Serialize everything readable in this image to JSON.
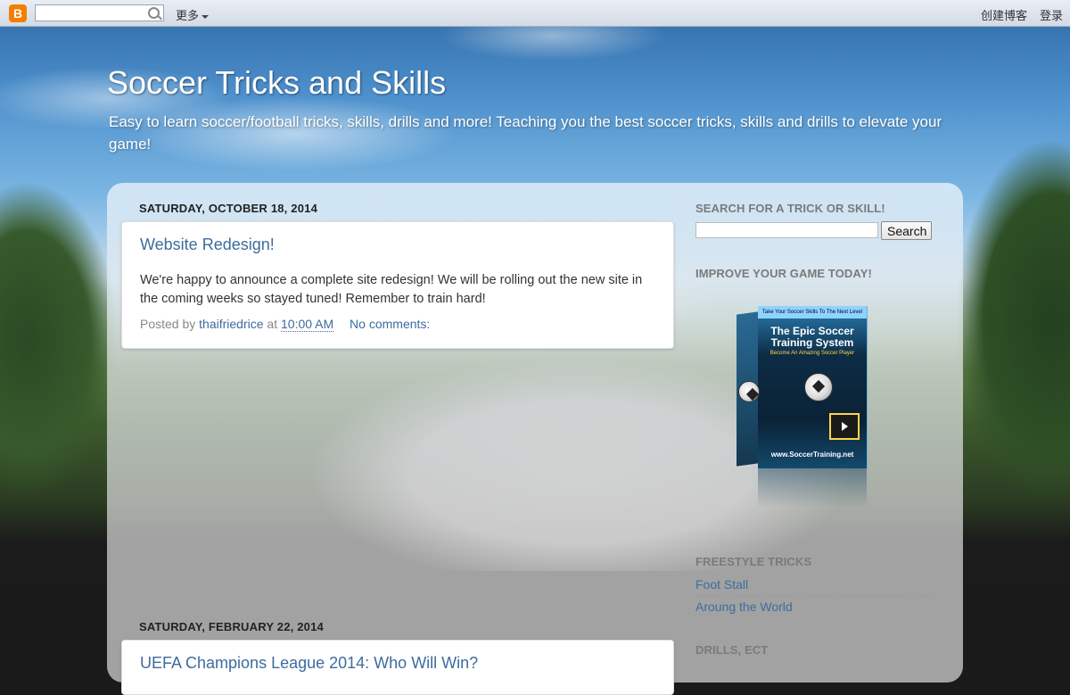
{
  "navbar": {
    "more_label": "更多",
    "create_blog": "创建博客",
    "login": "登录",
    "search_placeholder": ""
  },
  "header": {
    "title": "Soccer Tricks and Skills",
    "description": "Easy to learn soccer/football tricks, skills, drills and more! Teaching you the best soccer tricks, skills and drills to elevate your game!"
  },
  "posts": [
    {
      "date": "SATURDAY, OCTOBER 18, 2014",
      "title": "Website Redesign!",
      "body": "We're happy to announce a complete site redesign! We will be rolling out the new site in the coming weeks so stayed tuned! Remember to train hard!",
      "posted_by_label": "Posted by",
      "author": "thaifriedrice",
      "at_label": "at",
      "time": "10:00 AM",
      "comments": "No comments:"
    },
    {
      "date": "SATURDAY, FEBRUARY 22, 2014",
      "title": "UEFA Champions League 2014: Who Will Win?"
    }
  ],
  "sidebar": {
    "search": {
      "title": "SEARCH FOR A TRICK OR SKILL!",
      "button": "Search",
      "value": ""
    },
    "promo": {
      "title": "IMPROVE YOUR GAME TODAY!",
      "box_tagline": "Take Your Soccer Skills To The Next Level",
      "box_title": "The Epic Soccer Training System",
      "box_subtitle": "Become An Amazing Soccer Player",
      "box_url": "www.SoccerTraining.net"
    },
    "freestyle": {
      "title": "FREESTYLE TRICKS",
      "items": [
        "Foot Stall",
        "Aroung the World"
      ]
    },
    "drills": {
      "title": "DRILLS, ECT"
    }
  }
}
